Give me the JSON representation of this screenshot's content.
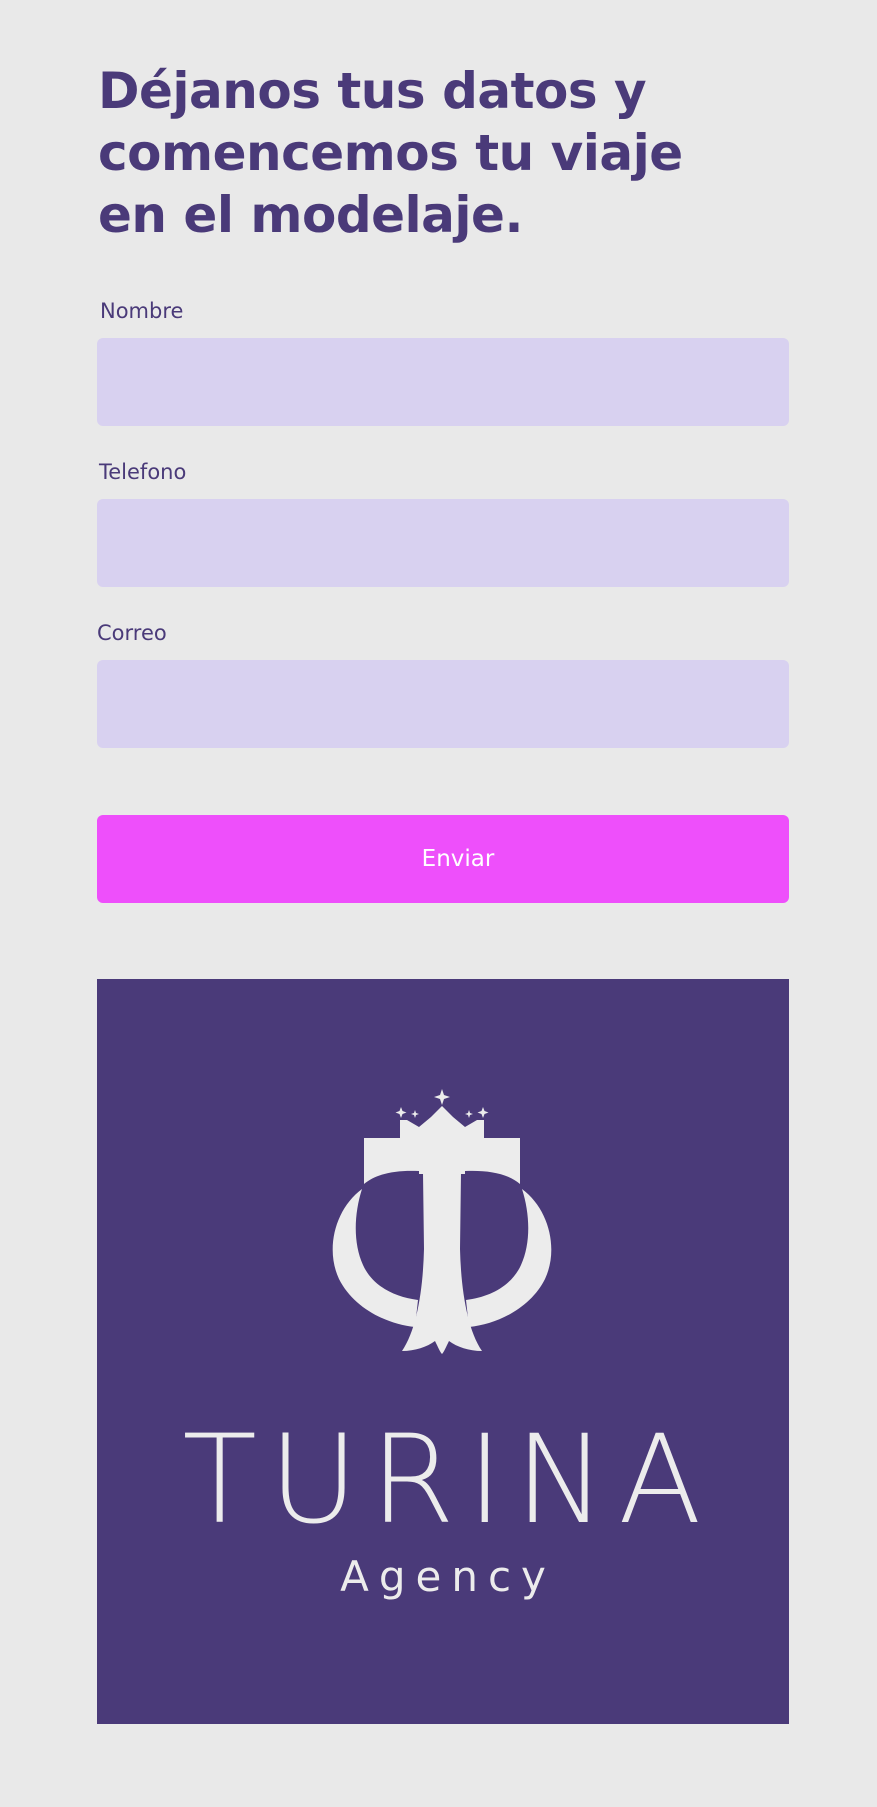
{
  "form": {
    "headline": "Déjanos tus datos y comencemos tu viaje en el modelaje.",
    "fields": [
      {
        "label": "Nombre",
        "value": "",
        "placeholder": ""
      },
      {
        "label": "Telefono",
        "value": "",
        "placeholder": ""
      },
      {
        "label": "Correo",
        "value": "",
        "placeholder": ""
      }
    ],
    "submit_label": "Enviar"
  },
  "brand": {
    "name": "TURINA",
    "tagline": "Agency",
    "emblem_icon": "crowned-t-emblem-icon"
  },
  "colors": {
    "page_background": "#e9e9e9",
    "primary": "#4a3a79",
    "input_background": "#d8d1f0",
    "accent": "#ee4ffb",
    "logo_foreground": "#ececec"
  }
}
